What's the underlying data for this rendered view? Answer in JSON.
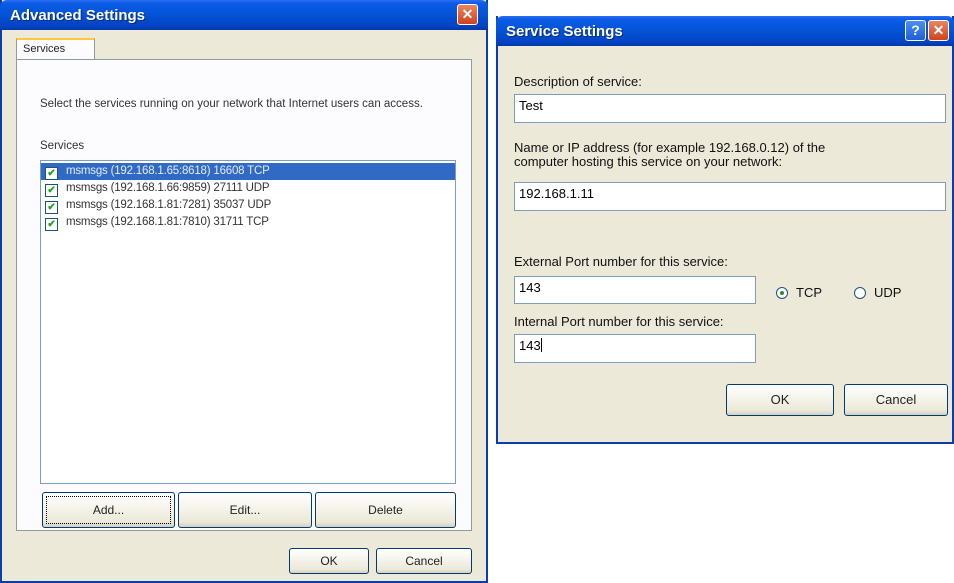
{
  "advanced": {
    "title": "Advanced Settings",
    "close_glyph": "✕",
    "tab_label": "Services",
    "instruction": "Select the services running on your network that Internet users can access.",
    "list_label": "Services",
    "items": [
      {
        "text": "msmsgs (192.168.1.65:8618) 16608 TCP",
        "checked": true,
        "selected": true
      },
      {
        "text": "msmsgs (192.168.1.66:9859) 27111 UDP",
        "checked": true,
        "selected": false
      },
      {
        "text": "msmsgs (192.168.1.81:7281) 35037 UDP",
        "checked": true,
        "selected": false
      },
      {
        "text": "msmsgs (192.168.1.81:7810) 31711 TCP",
        "checked": true,
        "selected": false
      }
    ],
    "add_label": "Add...",
    "edit_label": "Edit...",
    "delete_label": "Delete",
    "ok_label": "OK",
    "cancel_label": "Cancel"
  },
  "service": {
    "title": "Service Settings",
    "help_glyph": "?",
    "close_glyph": "✕",
    "description_label": "Description of service:",
    "description_value": "Test",
    "host_label_line1": "Name or IP address (for example 192.168.0.12) of the",
    "host_label_line2": "computer hosting this service on your network:",
    "host_value": "192.168.1.11",
    "external_port_label": "External Port number for this service:",
    "external_port_value": "143",
    "protocol_tcp": "TCP",
    "protocol_udp": "UDP",
    "protocol_selected": "TCP",
    "internal_port_label": "Internal Port number for this service:",
    "internal_port_value": "143",
    "ok_label": "OK",
    "cancel_label": "Cancel"
  }
}
